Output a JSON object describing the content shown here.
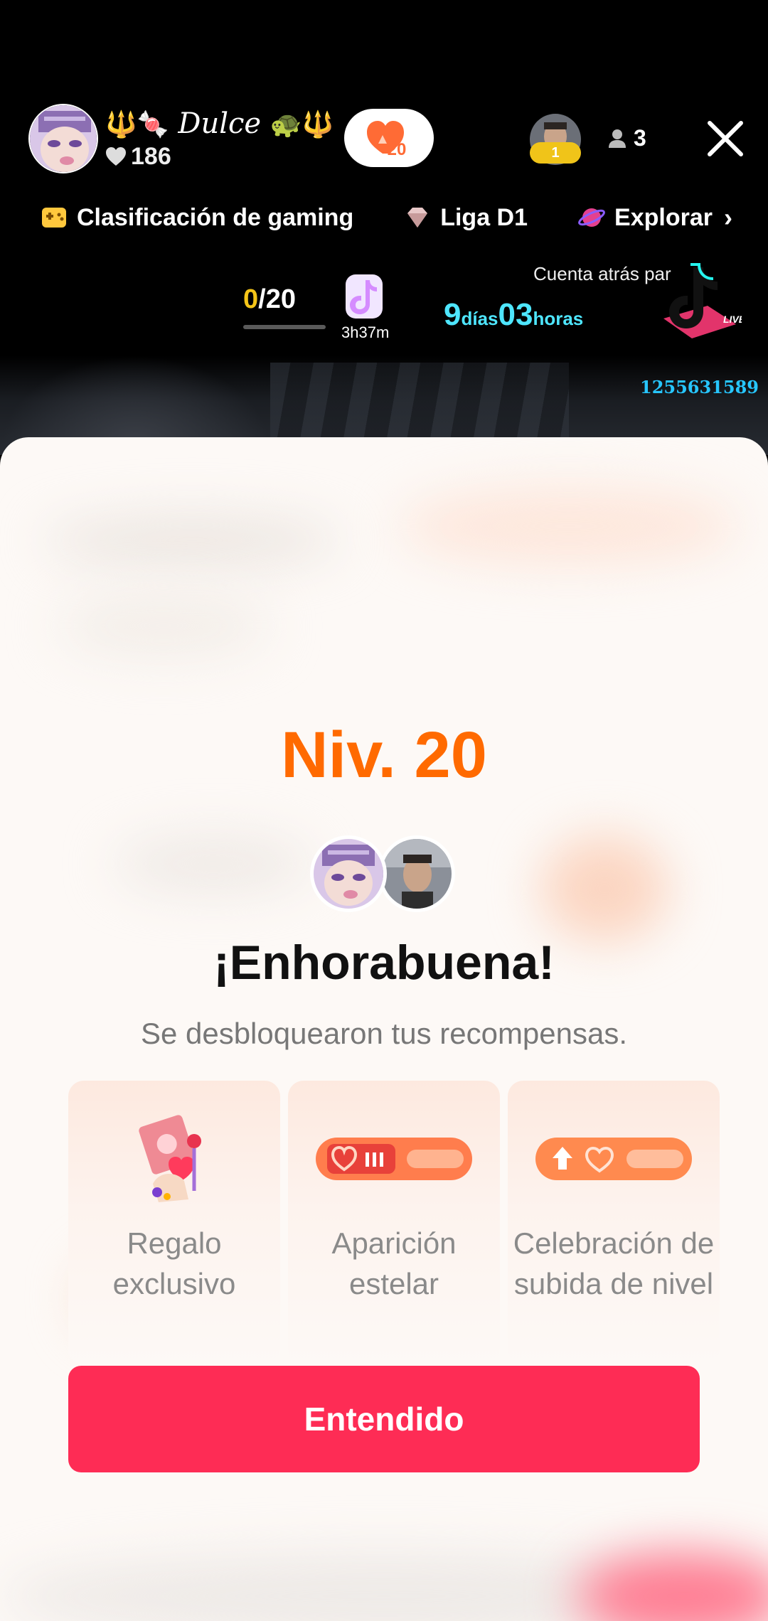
{
  "host": {
    "prefix_emoji": "🔱🍬",
    "name": "Dulce",
    "suffix_emoji": "🐢🔱",
    "likes": "186"
  },
  "level_pill": {
    "value": "20"
  },
  "viewer": {
    "badge_rank": "1",
    "count": "3"
  },
  "tags": [
    {
      "label": "Clasificación de gaming",
      "icon": "gamepad-icon"
    },
    {
      "label": "Liga D1",
      "icon": "diamond-icon"
    },
    {
      "label": "Explorar",
      "icon": "planet-icon"
    }
  ],
  "goal": {
    "current": "0",
    "total": "/20",
    "time_left": "3h37m"
  },
  "countdown": {
    "label": "Cuenta atrás par",
    "days_value": "9",
    "days_unit": "días",
    "hours_value": "03",
    "hours_unit": "horas"
  },
  "live_number": "1255631589",
  "sheet": {
    "level_title": "Niv. 20",
    "congrats": "¡Enhorabuena!",
    "unlock_text": "Se desbloquearon tus recompensas.",
    "rewards": [
      {
        "label": "Regalo exclusivo",
        "icon": "gift-hand-icon"
      },
      {
        "label": "Aparición estelar",
        "icon": "entrance-badge-icon"
      },
      {
        "label": "Celebración de subida de nivel",
        "icon": "level-up-badge-icon"
      }
    ],
    "ok_button": "Entendido"
  },
  "colors": {
    "accent_orange": "#ff6a00",
    "button_red": "#fe2c55",
    "countdown_cyan": "#4ee6ff",
    "goal_yellow": "#f5c518"
  }
}
